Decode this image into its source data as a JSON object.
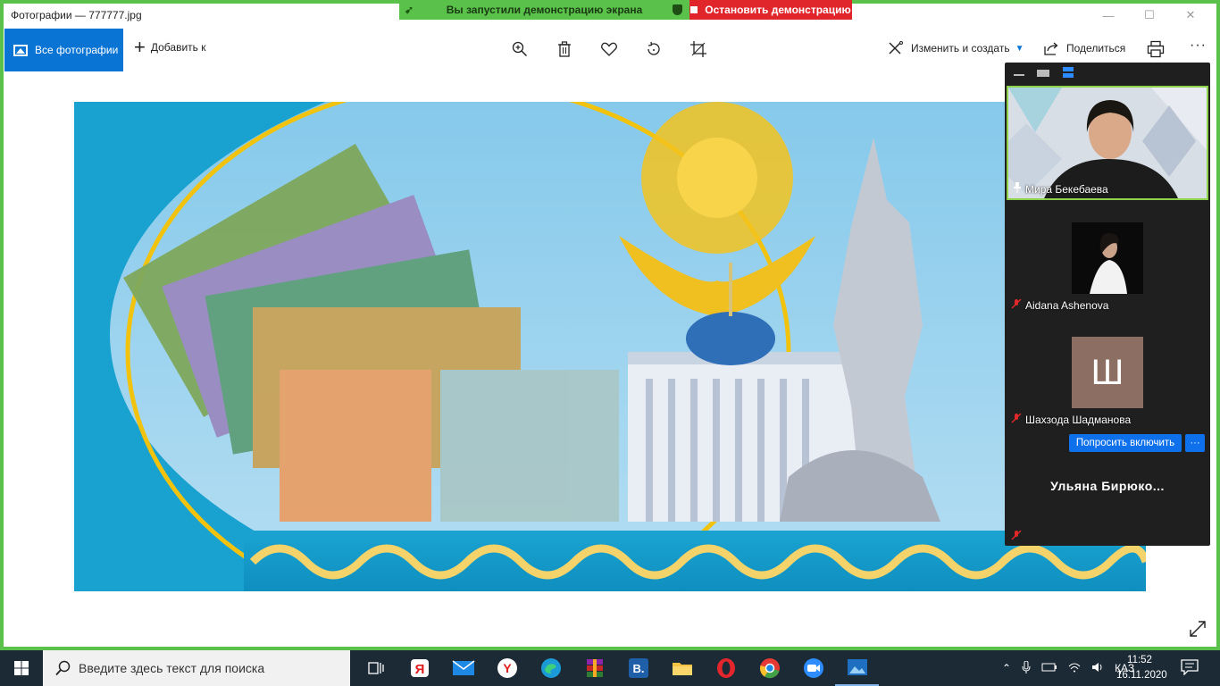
{
  "window": {
    "title": "Фотографии — 777777.jpg",
    "controls": [
      "—",
      "☐",
      "✕"
    ]
  },
  "share_banner": {
    "status_text": "Вы запустили демонстрацию экрана",
    "stop_label": "Остановить демонстрацию",
    "accent_green": "#5ac24a",
    "accent_red": "#e0262b"
  },
  "toolbar": {
    "all_photos_label": "Все фотографии",
    "add_to_label": "Добавить к",
    "edit_create_label": "Изменить и создать",
    "share_label": "Поделиться",
    "tools": [
      "zoom-in-icon",
      "trash-icon",
      "heart-icon",
      "rotate-icon",
      "crop-icon"
    ],
    "accent": "#0a74d4"
  },
  "zoom_panel": {
    "participants": [
      {
        "name": "Мира Бекебаева",
        "status": "pinned",
        "video": true
      },
      {
        "name": "Aidana Ashenova",
        "status": "muted",
        "video": true
      },
      {
        "name": "Шахзода Шадманова",
        "status": "muted",
        "video": false,
        "initial": "Ш"
      },
      {
        "name": "Ульяна  Бирюко...",
        "status": "muted",
        "video": false
      }
    ],
    "ask_to_unmute_label": "Попросить включить",
    "more_label": "···"
  },
  "taskbar": {
    "search_placeholder": "Введите здесь текст для поиска",
    "apps": [
      "task-view-icon",
      "yandex-browser-icon",
      "mail-icon",
      "yandex-icon",
      "edge-icon",
      "winrar-icon",
      "vk-icon",
      "file-explorer-icon",
      "opera-icon",
      "chrome-icon",
      "zoom-icon",
      "photos-icon"
    ],
    "language": "ҚАЗ",
    "time": "11:52",
    "date": "16.11.2020"
  }
}
